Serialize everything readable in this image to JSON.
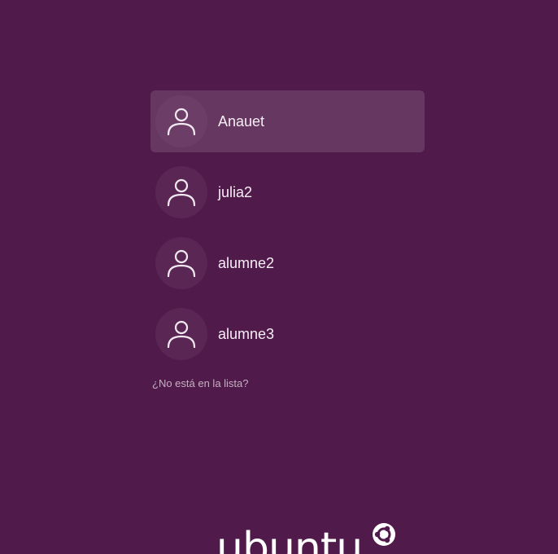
{
  "users": [
    {
      "name": "Anauet",
      "selected": true,
      "icon": "user-icon"
    },
    {
      "name": "julia2",
      "selected": false,
      "icon": "user-icon"
    },
    {
      "name": "alumne2",
      "selected": false,
      "icon": "user-icon"
    },
    {
      "name": "alumne3",
      "selected": false,
      "icon": "user-icon"
    }
  ],
  "not_listed_label": "¿No está en la lista?",
  "logo": {
    "text": "ubuntu",
    "icon": "circle-of-friends-icon"
  },
  "colors": {
    "background": "#501a4a",
    "selected_row": "rgba(255,255,255,0.13)",
    "text": "#f6eef5",
    "link": "#c6afc3"
  }
}
